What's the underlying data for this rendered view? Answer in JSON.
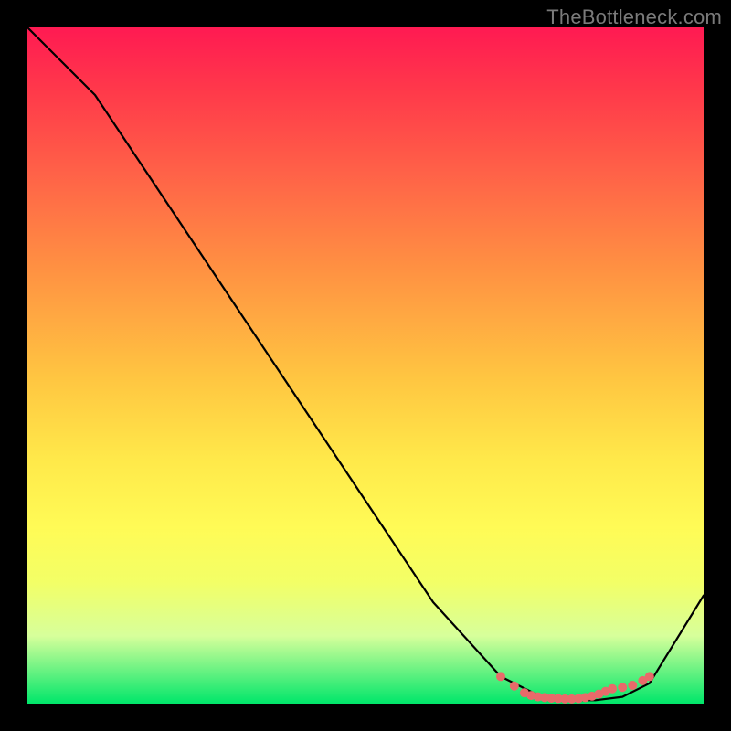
{
  "attribution": "TheBottleneck.com",
  "chart_data": {
    "type": "line",
    "title": "",
    "xlabel": "",
    "ylabel": "",
    "xlim": [
      0,
      100
    ],
    "ylim": [
      0,
      100
    ],
    "grid": false,
    "legend": false,
    "series": [
      {
        "name": "curve",
        "color": "#000000",
        "x": [
          0,
          10,
          20,
          30,
          40,
          50,
          60,
          70,
          76,
          80,
          84,
          88,
          92,
          100
        ],
        "y": [
          100,
          90,
          75,
          60,
          45,
          30,
          15,
          4,
          1,
          0.5,
          0.5,
          1,
          3,
          16
        ]
      }
    ],
    "markers": {
      "name": "valley-dots",
      "color": "#e86a6a",
      "radius": 5,
      "x": [
        70,
        72,
        73.5,
        74.5,
        75.5,
        76.5,
        77.5,
        78.5,
        79.5,
        80.5,
        81.5,
        82.5,
        83.5,
        84.5,
        85.5,
        86.5,
        88,
        89.5,
        91,
        92
      ],
      "y": [
        4,
        2.6,
        1.6,
        1.2,
        1.0,
        0.9,
        0.8,
        0.75,
        0.7,
        0.7,
        0.75,
        0.9,
        1.1,
        1.4,
        1.8,
        2.2,
        2.4,
        2.7,
        3.4,
        4.0
      ]
    }
  }
}
